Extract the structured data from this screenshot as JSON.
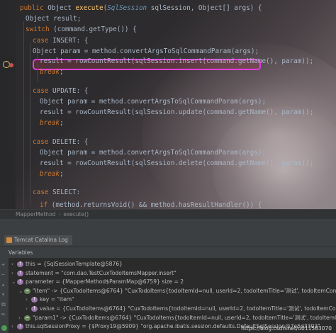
{
  "editor": {
    "lines": [
      {
        "parts": [
          [
            "kw",
            "public "
          ],
          [
            "ty",
            "Object "
          ],
          [
            "fn",
            "execute"
          ],
          [
            "ty",
            "("
          ],
          [
            "ann",
            "SqlSession"
          ],
          [
            "ty",
            " sqlSession, Object[] args) {"
          ]
        ]
      },
      {
        "parts": [
          [
            "ty",
            "Object result;"
          ]
        ]
      },
      {
        "parts": [
          [
            "kw",
            "switch "
          ],
          [
            "ty",
            "(command.getType()) {"
          ]
        ]
      },
      {
        "parts": [
          [
            "kw",
            "case "
          ],
          [
            "ty",
            "INSERT: {"
          ]
        ]
      },
      {
        "parts": [
          [
            "ty",
            "Object param = method.convertArgsToSqlCommandParam(args);"
          ]
        ]
      },
      {
        "parts": [
          [
            "ty",
            "result = rowCountResult(sqlSession.insert(command.getName(), param));"
          ]
        ]
      },
      {
        "parts": [
          [
            "it",
            "break"
          ],
          [
            "ty",
            ";"
          ]
        ]
      },
      {
        "parts": [
          [
            "ty",
            ""
          ]
        ]
      },
      {
        "parts": [
          [
            "kw",
            "case "
          ],
          [
            "ty",
            "UPDATE: {"
          ]
        ]
      },
      {
        "parts": [
          [
            "ty",
            "Object param = method.convertArgsToSqlCommandParam(args);"
          ]
        ]
      },
      {
        "parts": [
          [
            "ty",
            "result = rowCountResult(sqlSession.update(command.getName(), param));"
          ]
        ]
      },
      {
        "parts": [
          [
            "it",
            "break"
          ],
          [
            "ty",
            ";"
          ]
        ]
      },
      {
        "parts": [
          [
            "ty",
            ""
          ]
        ]
      },
      {
        "parts": [
          [
            "kw",
            "case "
          ],
          [
            "ty",
            "DELETE: {"
          ]
        ]
      },
      {
        "parts": [
          [
            "ty",
            "Object param = method.convertArgsToSqlCommandParam(args);"
          ]
        ]
      },
      {
        "parts": [
          [
            "ty",
            "result = rowCountResult(sqlSession.delete(command.getName(), param));"
          ]
        ]
      },
      {
        "parts": [
          [
            "it",
            "break"
          ],
          [
            "ty",
            ";"
          ]
        ]
      },
      {
        "parts": [
          [
            "ty",
            ""
          ]
        ]
      },
      {
        "parts": [
          [
            "kw",
            "case "
          ],
          [
            "ty",
            "SELECT:"
          ]
        ]
      },
      {
        "parts": [
          [
            "kw",
            "if "
          ],
          [
            "ty",
            "(method.returnsVoid() && method.hasResultHandler()) {"
          ]
        ]
      }
    ]
  },
  "breadcrumb": {
    "class_name": "MapperMethod",
    "method_name": "execute()",
    "separator": "›"
  },
  "tool_window": {
    "tab_label": "Tomcat Catalina Log",
    "panel_title": "Variables"
  },
  "variables": [
    {
      "arrow": "›",
      "name": "this",
      "value": " = {SqlSessionTemplate@5876}"
    },
    {
      "arrow": "›",
      "name": "statement",
      "value": " = \"com.dao.TestCuxTodoItemsMapper.insert\""
    },
    {
      "arrow": "⌄",
      "name": "parameter",
      "value": " = {MapperMethod$ParamMap@6759}  size = 2"
    },
    {
      "arrow": "⌄",
      "name": "\"item\"",
      "value": " -> {CuxTodoItems@6764} \"CuxTodoItems{todoItemId=null, userId=2, todoItemTitle='测试', todoItemConte"
    },
    {
      "arrow": "›",
      "name": "key",
      "value": " = \"item\""
    },
    {
      "arrow": "›",
      "name": "value",
      "value": " = {CuxTodoItems@6764} \"CuxTodoItems{todoItemId=null, userId=2, todoItemTitle='测试', todoItemConte"
    },
    {
      "arrow": "›",
      "name": "\"param1\"",
      "value": " -> {CuxTodoItems@6764} \"CuxTodoItems{todoItemId=null, userId=2, todoItemTitle='测试', todoItemConte"
    },
    {
      "arrow": "›",
      "name": "this.sqlSessionProxy",
      "value": " = {$Proxy19@5909} \"org.apache.ibatis.session.defaults.DefaultSqlSession@7e5d3303\""
    }
  ],
  "watermark": "https://blog.csdn.net/u011583070"
}
